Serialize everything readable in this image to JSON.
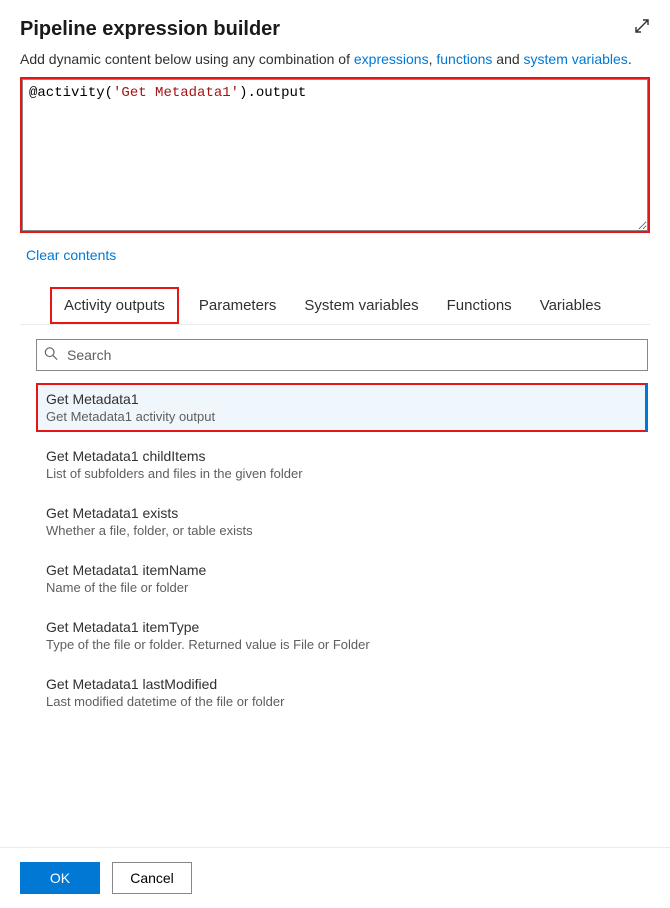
{
  "header": {
    "title": "Pipeline expression builder",
    "intro_prefix": "Add dynamic content below using any combination of ",
    "link1": "expressions",
    "sep1": ", ",
    "link2": "functions",
    "sep2": " and ",
    "link3": "system variables",
    "intro_suffix": "."
  },
  "editor": {
    "expression_parts": {
      "at": "@",
      "fn": "activity",
      "open": "(",
      "str": "'Get Metadata1'",
      "close": ")",
      "dot": ".",
      "prop": "output"
    },
    "clear_label": "Clear contents"
  },
  "tabs": {
    "items": [
      {
        "label": "Activity outputs",
        "active": true
      },
      {
        "label": "Parameters"
      },
      {
        "label": "System variables"
      },
      {
        "label": "Functions"
      },
      {
        "label": "Variables"
      }
    ]
  },
  "search": {
    "placeholder": "Search"
  },
  "list": {
    "items": [
      {
        "title": "Get Metadata1",
        "desc": "Get Metadata1 activity output",
        "selected": true
      },
      {
        "title": "Get Metadata1 childItems",
        "desc": "List of subfolders and files in the given folder"
      },
      {
        "title": "Get Metadata1 exists",
        "desc": "Whether a file, folder, or table exists"
      },
      {
        "title": "Get Metadata1 itemName",
        "desc": "Name of the file or folder"
      },
      {
        "title": "Get Metadata1 itemType",
        "desc": "Type of the file or folder. Returned value is File or Folder"
      },
      {
        "title": "Get Metadata1 lastModified",
        "desc": "Last modified datetime of the file or folder"
      }
    ]
  },
  "footer": {
    "ok": "OK",
    "cancel": "Cancel"
  }
}
